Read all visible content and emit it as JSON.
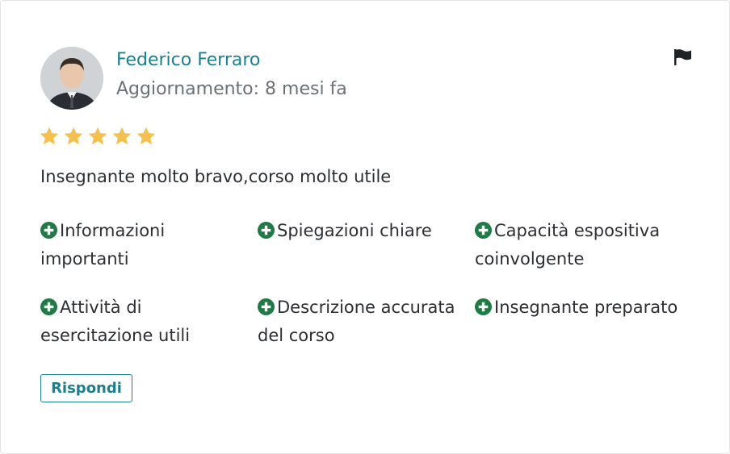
{
  "review": {
    "author_name": "Federico Ferraro",
    "updated_text": "Aggiornamento: 8 mesi fa",
    "rating": 5,
    "rating_max": 5,
    "text": "Insegnante molto bravo,corso molto utile",
    "tags": [
      "Informazioni importanti",
      "Spiegazioni chiare",
      "Capacità espositiva coinvolgente",
      "Attività di esercitazione utili",
      "Descrizione accurata del corso",
      "Insegnante preparato"
    ],
    "reply_label": "Rispondi"
  },
  "icons": {
    "flag": "flag-icon",
    "star": "star-icon",
    "tag": "plus-circle-icon"
  },
  "colors": {
    "accent": "#1a7f8f",
    "star": "#f4c150",
    "tag_icon": "#1f7a45",
    "muted_text": "#6b7177",
    "body_text": "#2b2f33"
  }
}
